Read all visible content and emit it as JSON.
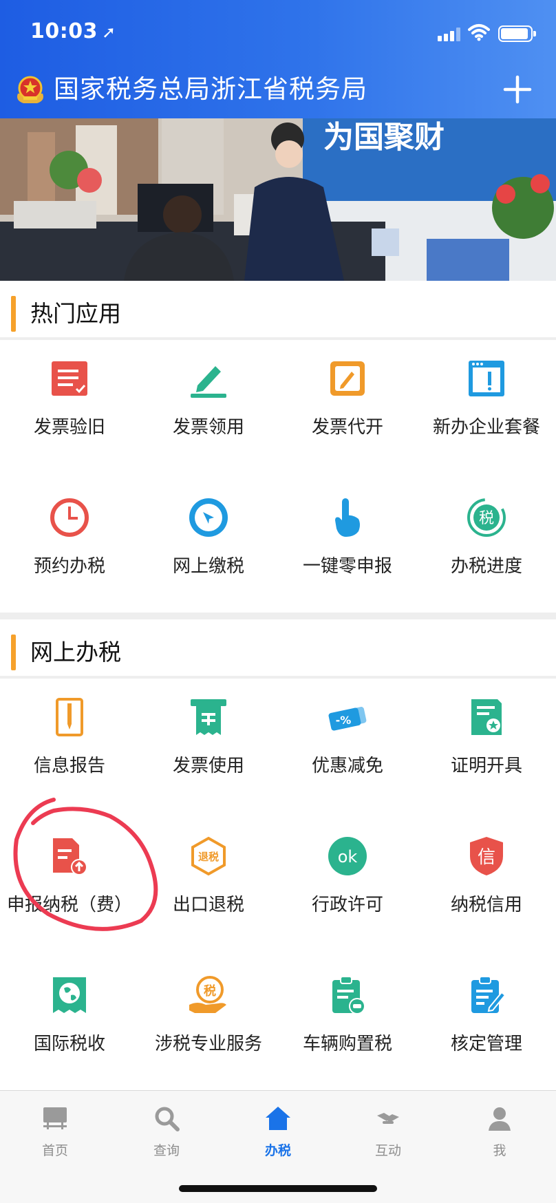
{
  "status_bar": {
    "time": "10:03"
  },
  "header": {
    "title": "国家税务总局浙江省税务局"
  },
  "banner": {
    "sign_text": "为国聚财"
  },
  "hot_apps": {
    "title": "热门应用",
    "items": [
      {
        "label": "发票验旧",
        "icon": "invoice-check-icon",
        "color": "#e8524a"
      },
      {
        "label": "发票领用",
        "icon": "pen-write-icon",
        "color": "#2bb38e"
      },
      {
        "label": "发票代开",
        "icon": "edit-box-icon",
        "color": "#f09a2a"
      },
      {
        "label": "新办企业套餐",
        "icon": "browser-window-icon",
        "color": "#1f9ae0"
      },
      {
        "label": "预约办税",
        "icon": "clock-icon",
        "color": "#e8524a"
      },
      {
        "label": "网上缴税",
        "icon": "compass-icon",
        "color": "#1f9ae0"
      },
      {
        "label": "一键零申报",
        "icon": "finger-tap-icon",
        "color": "#1f9ae0"
      },
      {
        "label": "办税进度",
        "icon": "tax-progress-icon",
        "color": "#2bb38e",
        "glyph": "税"
      }
    ]
  },
  "online_tax": {
    "title": "网上办税",
    "items": [
      {
        "label": "信息报告",
        "icon": "report-doc-icon",
        "color": "#f09a2a"
      },
      {
        "label": "发票使用",
        "icon": "receipt-icon",
        "color": "#2bb38e"
      },
      {
        "label": "优惠减免",
        "icon": "discount-ticket-icon",
        "color": "#1f9ae0",
        "glyph": "-%"
      },
      {
        "label": "证明开具",
        "icon": "certificate-icon",
        "color": "#2bb38e"
      },
      {
        "label": "申报纳税（费）",
        "icon": "declare-upload-icon",
        "color": "#e8524a"
      },
      {
        "label": "出口退税",
        "icon": "export-refund-icon",
        "color": "#f09a2a",
        "glyph": "退税"
      },
      {
        "label": "行政许可",
        "icon": "ok-badge-icon",
        "color": "#2bb38e",
        "glyph": "ok"
      },
      {
        "label": "纳税信用",
        "icon": "credit-shield-icon",
        "color": "#e8524a",
        "glyph": "信"
      },
      {
        "label": "国际税收",
        "icon": "globe-icon",
        "color": "#2bb38e"
      },
      {
        "label": "涉税专业服务",
        "icon": "tax-service-hand-icon",
        "color": "#f09a2a",
        "glyph": "税"
      },
      {
        "label": "车辆购置税",
        "icon": "vehicle-tax-icon",
        "color": "#2bb38e"
      },
      {
        "label": "核定管理",
        "icon": "clipboard-edit-icon",
        "color": "#1f9ae0"
      }
    ]
  },
  "tabbar": {
    "items": [
      {
        "label": "首页",
        "icon": "billboard-icon"
      },
      {
        "label": "查询",
        "icon": "search-icon"
      },
      {
        "label": "办税",
        "icon": "house-icon",
        "active": true
      },
      {
        "label": "互动",
        "icon": "handshake-icon"
      },
      {
        "label": "我",
        "icon": "person-icon"
      }
    ]
  }
}
